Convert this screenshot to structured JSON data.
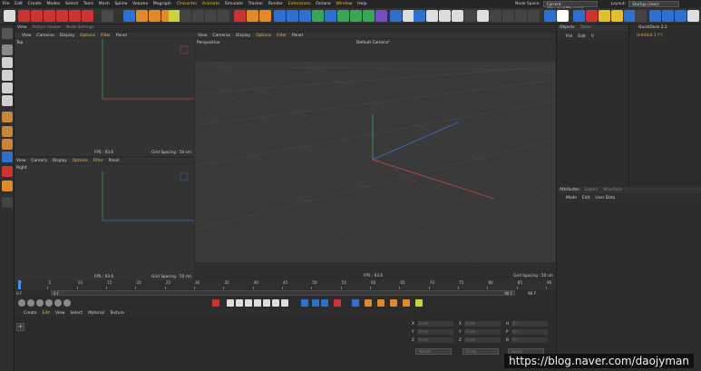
{
  "menu": [
    "File",
    "Edit",
    "Create",
    "Modes",
    "Select",
    "Tools",
    "Mesh",
    "Spline",
    "Volume",
    "Mograph",
    "Character",
    "Animate",
    "Simulate",
    "Tracker",
    "Render",
    "Extensions",
    "Octane",
    "Window",
    "Help"
  ],
  "menu_highlight": [
    "Character",
    "Animate",
    "Extensions",
    "Window"
  ],
  "node_space_label": "Node Space:",
  "node_space_value": "Current (Standard/Physical)",
  "layout_label": "Layout:",
  "layout_value": "Startup (User)",
  "viewport_tabs": [
    "View",
    "Picture Viewer",
    "Node Settings"
  ],
  "view_menu": [
    "View",
    "Cameras",
    "Display",
    "Options",
    "Filter",
    "Panel"
  ],
  "view_menu_small": [
    "View",
    "Camera",
    "Display",
    "Options",
    "Filter",
    "Panel"
  ],
  "views": {
    "top": {
      "label": "Top",
      "fps": "FPS : 93.6",
      "grid": "Grid Spacing : 50 cm"
    },
    "right": {
      "label": "Right",
      "fps": "FPS : 93.6",
      "grid": "Grid Spacing : 50 cm"
    },
    "perspective": {
      "label": "Perspective",
      "camera": "Default Camera*",
      "fps": "FPS : 93.6",
      "grid": "Grid Spacing : 50 cm"
    }
  },
  "objects_tabs": [
    "Objects",
    "Takes"
  ],
  "objects_menu": [
    "File",
    "Edit",
    "V"
  ],
  "quickdock": {
    "title": "QuickDock 2.2",
    "item": "Untitled 1 (*)"
  },
  "attributes_tabs": [
    "Attributes",
    "Layers",
    "Structure"
  ],
  "attributes_menu": [
    "Mode",
    "Edit",
    "User Data"
  ],
  "timeline": {
    "ticks": [
      "0",
      "5",
      "10",
      "15",
      "20",
      "25",
      "30",
      "35",
      "40",
      "45",
      "50",
      "55",
      "60",
      "65",
      "70",
      "75",
      "80",
      "85",
      "90"
    ],
    "current_frame": "0 F",
    "start": "0 F",
    "start2": "0 F",
    "end": "90 F",
    "end2": "90 F"
  },
  "material_menu": [
    "Create",
    "Edit",
    "View",
    "Select",
    "Material",
    "Texture"
  ],
  "coords": {
    "rows": [
      {
        "a": "X",
        "av": "0 cm",
        "b": "X",
        "bv": "0 cm",
        "c": "H",
        "cv": "0 °"
      },
      {
        "a": "Y",
        "av": "0 cm",
        "b": "Y",
        "bv": "0 cm",
        "c": "P",
        "cv": "0 °"
      },
      {
        "a": "Z",
        "av": "0 cm",
        "b": "Z",
        "bv": "0 cm",
        "c": "B",
        "cv": "0 °"
      }
    ],
    "mode1": "World",
    "mode2": "Scale",
    "apply": "Apply"
  },
  "watermark": "https://blog.naver.com/daojyman",
  "colors": {
    "accent": "#e8b73a",
    "axis_x": "#c8484a",
    "axis_y": "#3aa65a",
    "axis_z": "#3d6fd0"
  }
}
